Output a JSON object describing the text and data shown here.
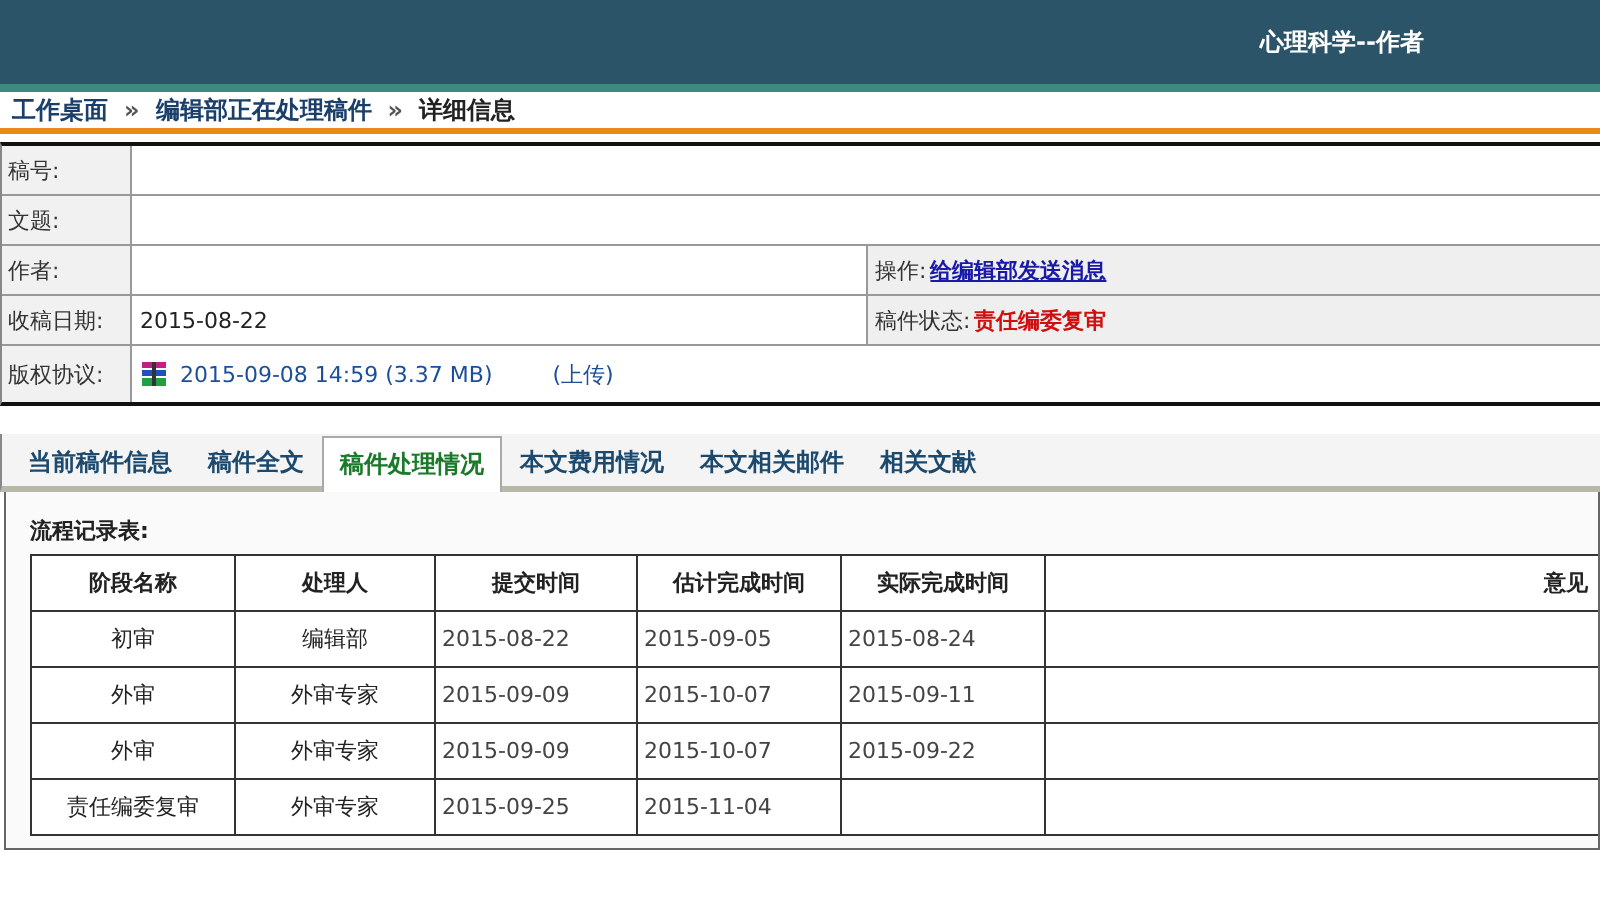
{
  "header": {
    "title": "心理科学--作者"
  },
  "breadcrumb": [
    {
      "label": "工作桌面",
      "link": true
    },
    {
      "separator": "»",
      "label": "编辑部正在处理稿件",
      "link": true
    },
    {
      "separator": "»",
      "label": "详细信息",
      "link": false
    }
  ],
  "info": {
    "manuscript_no_label": "稿号:",
    "title_label": "文题:",
    "author_label": "作者:",
    "action": {
      "label": "操作:",
      "link": "给编辑部发送消息"
    },
    "received": {
      "label": "收稿日期:",
      "value": "2015-08-22"
    },
    "status": {
      "label": "稿件状态:",
      "value": "责任编委复审"
    },
    "copyright": {
      "label": "版权协议:",
      "file": "2015-09-08 14:59 (3.37 MB)",
      "upload": "(上传)"
    }
  },
  "tabs": [
    {
      "label": "当前稿件信息",
      "selected": false
    },
    {
      "label": "稿件全文",
      "selected": false
    },
    {
      "label": "稿件处理情况",
      "selected": true
    },
    {
      "label": "本文费用情况",
      "selected": false
    },
    {
      "label": "本文相关邮件",
      "selected": false
    },
    {
      "label": "相关文献",
      "selected": false
    }
  ],
  "process": {
    "title": "流程记录表:",
    "columns": [
      "阶段名称",
      "处理人",
      "提交时间",
      "估计完成时间",
      "实际完成时间",
      "意见"
    ],
    "rows": [
      [
        "初审",
        "编辑部",
        "2015-08-22",
        "2015-09-05",
        "2015-08-24",
        ""
      ],
      [
        "外审",
        "外审专家",
        "2015-09-09",
        "2015-10-07",
        "2015-09-11",
        ""
      ],
      [
        "外审",
        "外审专家",
        "2015-09-09",
        "2015-10-07",
        "2015-09-22",
        ""
      ],
      [
        "责任编委复审",
        "外审专家",
        "2015-09-25",
        "2015-11-04",
        "",
        ""
      ]
    ]
  }
}
